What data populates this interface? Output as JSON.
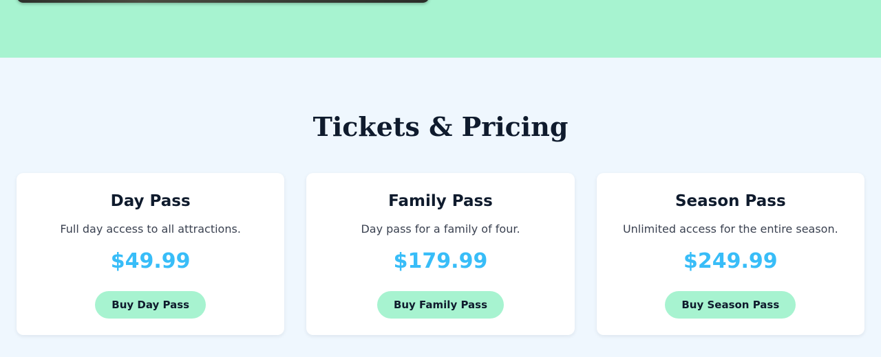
{
  "pricing": {
    "title": "Tickets & Pricing",
    "plans": [
      {
        "name": "Day Pass",
        "description": "Full day access to all attractions.",
        "price": "$49.99",
        "button_label": "Buy Day Pass"
      },
      {
        "name": "Family Pass",
        "description": "Day pass for a family of four.",
        "price": "$179.99",
        "button_label": "Buy Family Pass"
      },
      {
        "name": "Season Pass",
        "description": "Unlimited access for the entire season.",
        "price": "$249.99",
        "button_label": "Buy Season Pass"
      }
    ]
  },
  "colors": {
    "hero_background": "#a7f3d0",
    "section_background": "#eff7fe",
    "price": "#38bdf8",
    "button": "#a7f3d0",
    "heading": "#0f1b2d"
  }
}
